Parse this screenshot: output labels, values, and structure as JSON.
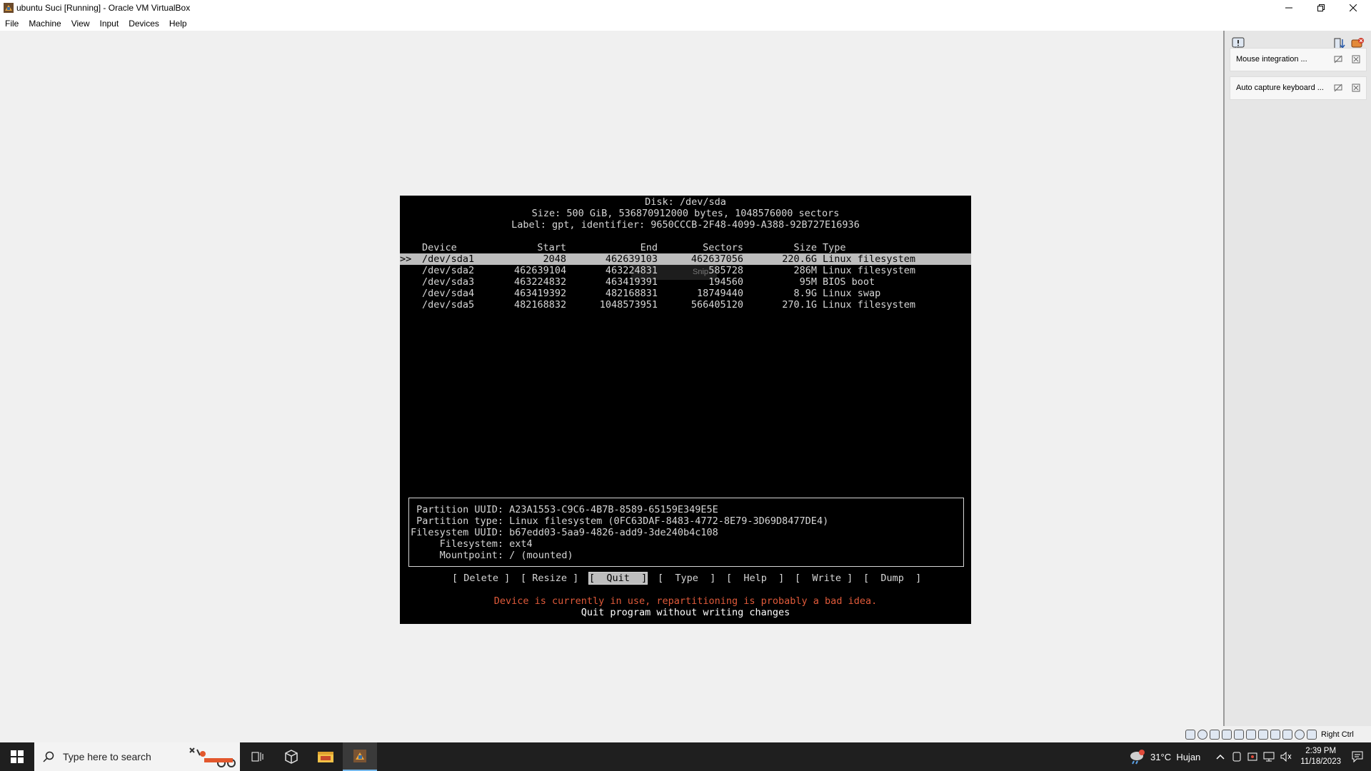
{
  "window": {
    "title": "ubuntu Suci [Running] - Oracle VM VirtualBox"
  },
  "menu": [
    "File",
    "Machine",
    "View",
    "Input",
    "Devices",
    "Help"
  ],
  "cfdisk": {
    "header": [
      "Disk: /dev/sda",
      "Size: 500 GiB, 536870912000 bytes, 1048576000 sectors",
      "Label: gpt, identifier: 9650CCCB-2F48-4099-A388-92B727E16936"
    ],
    "columns": [
      "Device",
      "Start",
      "End",
      "Sectors",
      "Size",
      "Type"
    ],
    "rows": [
      {
        "marker": ">>",
        "device": "/dev/sda1",
        "start": "2048",
        "end": "462639103",
        "sectors": "462637056",
        "size": "220.6G",
        "type": "Linux filesystem"
      },
      {
        "marker": "",
        "device": "/dev/sda2",
        "start": "462639104",
        "end": "463224831",
        "sectors": "585728",
        "size": "286M",
        "type": "Linux filesystem"
      },
      {
        "marker": "",
        "device": "/dev/sda3",
        "start": "463224832",
        "end": "463419391",
        "sectors": "194560",
        "size": "95M",
        "type": "BIOS boot"
      },
      {
        "marker": "",
        "device": "/dev/sda4",
        "start": "463419392",
        "end": "482168831",
        "sectors": "18749440",
        "size": "8.9G",
        "type": "Linux swap"
      },
      {
        "marker": "",
        "device": "/dev/sda5",
        "start": "482168832",
        "end": "1048573951",
        "sectors": "566405120",
        "size": "270.1G",
        "type": "Linux filesystem"
      }
    ],
    "snip_ghost": "Snip",
    "info": [
      " Partition UUID: A23A1553-C9C6-4B7B-8589-65159E349E5E",
      " Partition type: Linux filesystem (0FC63DAF-8483-4772-8E79-3D69D8477DE4)",
      "Filesystem UUID: b67edd03-5aa9-4826-add9-3de240b4c108",
      "     Filesystem: ext4",
      "     Mountpoint: / (mounted)"
    ],
    "buttons": [
      "[ Delete ]",
      "[ Resize ]",
      "[  Quit  ]",
      "[  Type  ]",
      "[  Help  ]",
      "[  Write ]",
      "[  Dump  ]"
    ],
    "selected_button": "[  Quit  ]",
    "warning": "Device is currently in use, repartitioning is probably a bad idea.",
    "hint": "Quit program without writing changes"
  },
  "notifications": {
    "mouse": "Mouse integration ...",
    "keyboard": "Auto capture keyboard ..."
  },
  "statusbar": {
    "host_key": "Right Ctrl"
  },
  "taskbar": {
    "search_placeholder": "Type here to search",
    "weather": "31°C  Hujan",
    "time": "2:39 PM",
    "date": "11/18/2023"
  },
  "colors": {
    "warning": "#e05a3a",
    "terminal_bg": "#000000",
    "selection": "#bdbdbd"
  }
}
